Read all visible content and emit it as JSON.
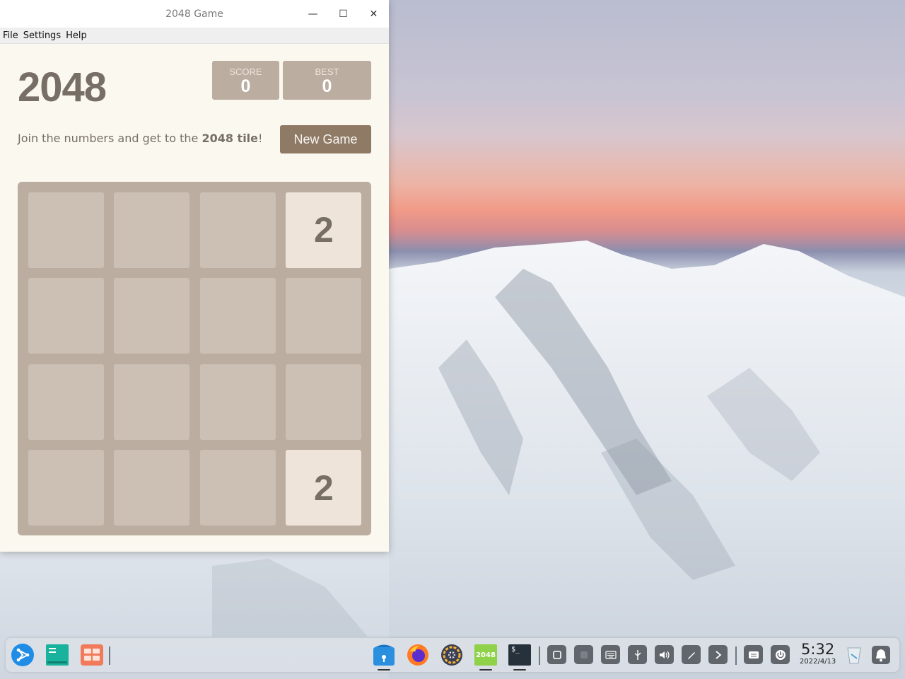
{
  "window": {
    "title": "2048 Game",
    "controls": {
      "minimize": "—",
      "maximize": "☐",
      "close": "✕"
    }
  },
  "menu": {
    "items": [
      "File",
      "Settings",
      "Help"
    ]
  },
  "game": {
    "title": "2048",
    "score_label": "SCORE",
    "score_value": "0",
    "best_label": "BEST",
    "best_value": "0",
    "intro_prefix": "Join the numbers and get to the ",
    "intro_bold": "2048 tile",
    "intro_suffix": "!",
    "new_game_label": "New Game",
    "board": [
      [
        "",
        "",
        "",
        "2"
      ],
      [
        "",
        "",
        "",
        ""
      ],
      [
        "",
        "",
        "",
        ""
      ],
      [
        "",
        "",
        "",
        "2"
      ]
    ],
    "colors": {
      "background": "#faf8ef",
      "board": "#bbada0",
      "tile_2": "#eee4da",
      "text": "#776e65",
      "button": "#8f7a66"
    }
  },
  "taskbar": {
    "launcher_icon": "launcher-icon",
    "apps_left": [
      "multitasking-view-icon",
      "workspace-icon"
    ],
    "apps_center": [
      {
        "name": "app-store-icon"
      },
      {
        "name": "firefox-icon"
      },
      {
        "name": "settings-icon"
      },
      {
        "name": "2048-app-icon",
        "label": "2048"
      },
      {
        "name": "terminal-icon",
        "label": "$_"
      }
    ],
    "tray": [
      "window-icon",
      "window-alt-icon",
      "keyboard-icon",
      "usb-icon",
      "volume-icon",
      "pen-icon",
      "expand-arrow-icon",
      "input-method-icon",
      "power-icon"
    ],
    "clock_time": "5:32",
    "clock_date": "2022/4/13",
    "trash_icon": "trash-icon",
    "notification_icon": "notification-bell-icon"
  }
}
